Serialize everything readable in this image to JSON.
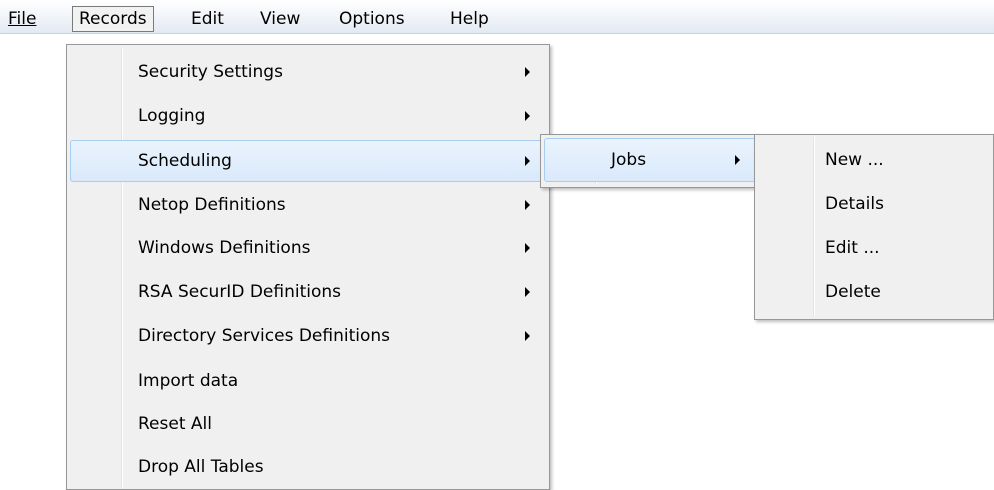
{
  "menubar": {
    "items": [
      {
        "label": "File",
        "active": false
      },
      {
        "label": "Records",
        "active": true
      },
      {
        "label": "Edit",
        "active": false
      },
      {
        "label": "View",
        "active": false
      },
      {
        "label": "Options",
        "active": false
      },
      {
        "label": "Help",
        "active": false
      }
    ]
  },
  "records_menu": {
    "items": [
      {
        "label": "Security Settings",
        "submenu": true
      },
      {
        "label": "Logging",
        "submenu": true
      },
      {
        "label": "Scheduling",
        "submenu": true,
        "highlighted": true
      },
      {
        "label": "Netop Definitions",
        "submenu": true
      },
      {
        "label": "Windows Definitions",
        "submenu": true
      },
      {
        "label": "RSA SecurID Definitions",
        "submenu": true
      },
      {
        "label": "Directory Services Definitions",
        "submenu": true
      },
      {
        "label": "Import data",
        "submenu": false
      },
      {
        "label": "Reset All",
        "submenu": false
      },
      {
        "label": "Drop All Tables",
        "submenu": false
      }
    ]
  },
  "scheduling_menu": {
    "items": [
      {
        "label": "Jobs",
        "submenu": true,
        "highlighted": true
      }
    ]
  },
  "jobs_menu": {
    "items": [
      {
        "label": "New ..."
      },
      {
        "label": "Details"
      },
      {
        "label": "Edit ..."
      },
      {
        "label": "Delete"
      }
    ]
  },
  "colors": {
    "menu_bg": "#f0f0f0",
    "menu_border": "#979797",
    "highlight_bg": "#dbeafb",
    "highlight_border": "#a8cdf1"
  }
}
